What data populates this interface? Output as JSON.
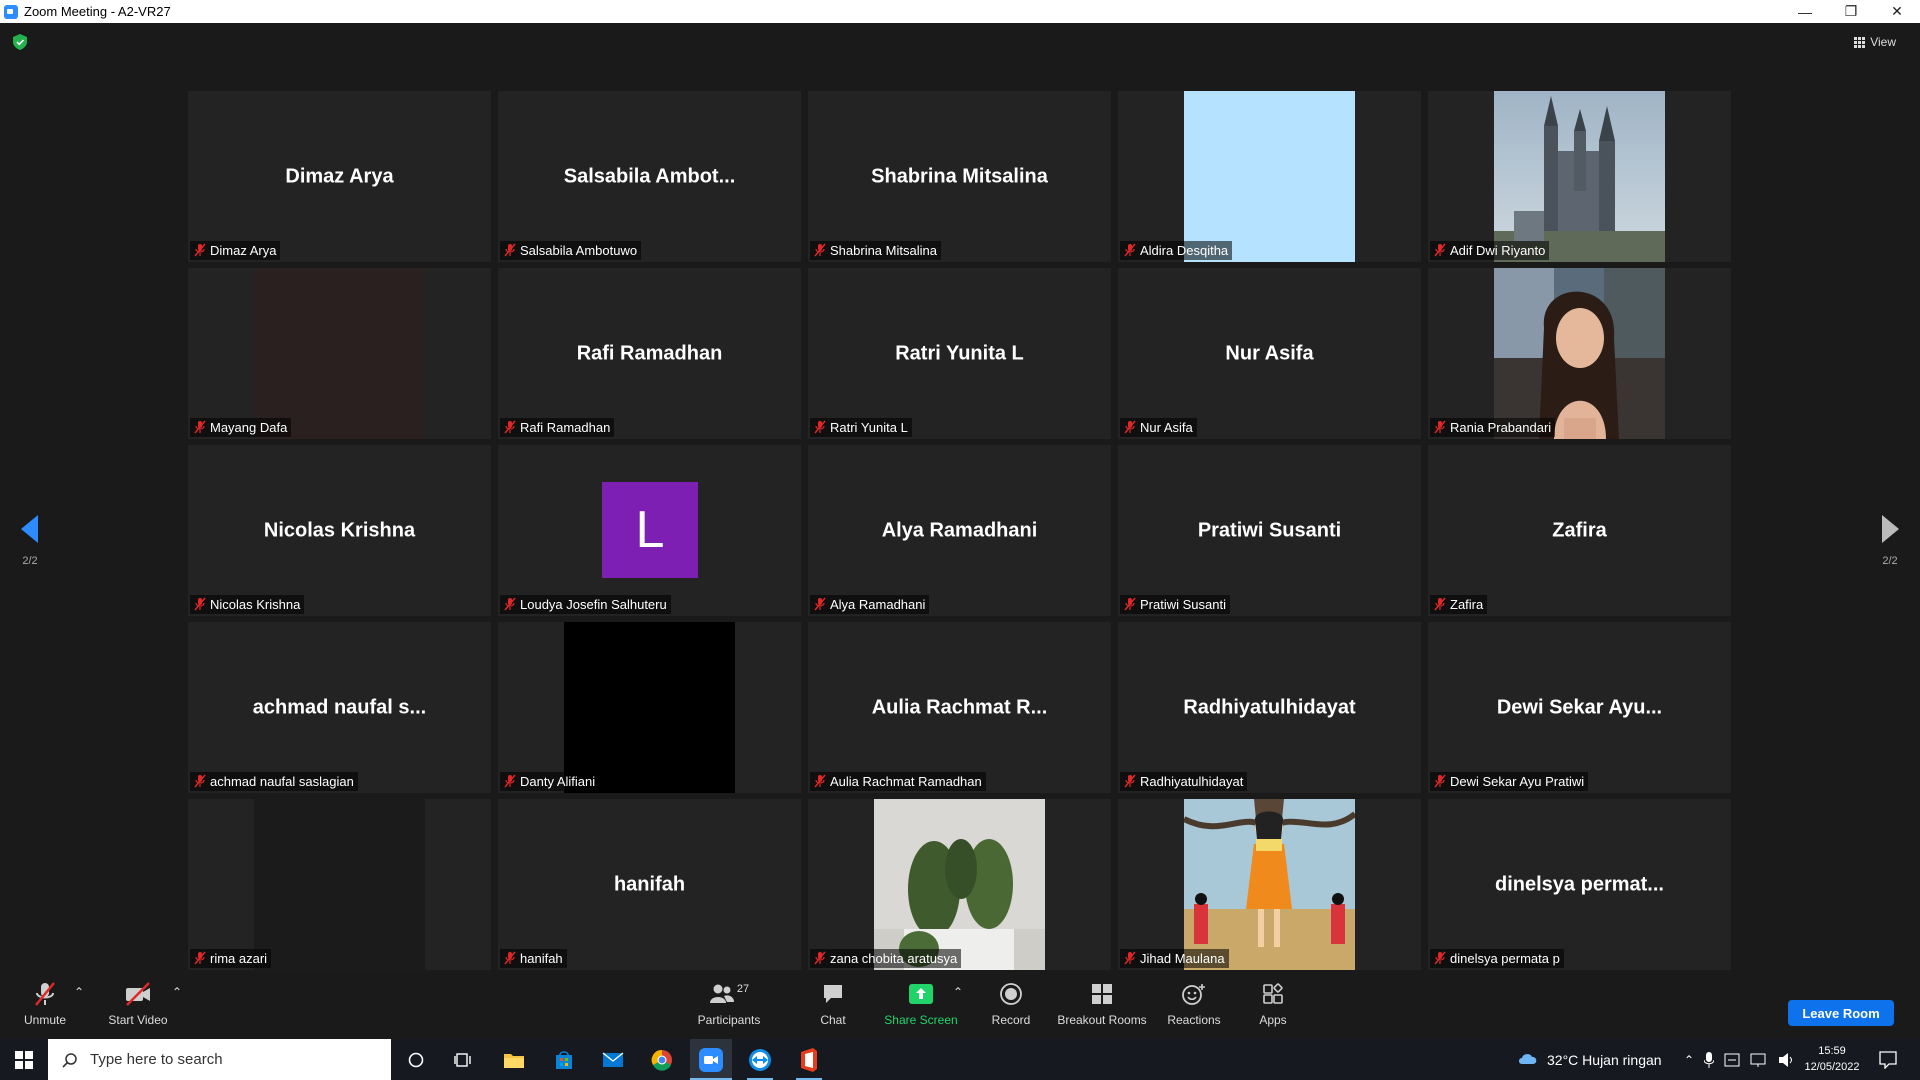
{
  "window": {
    "title": "Zoom Meeting - A2-VR27"
  },
  "view_label": "View",
  "pagination": {
    "left": "2/2",
    "right": "2/2"
  },
  "tiles": [
    {
      "display": "Dimaz Arya",
      "name": "Dimaz Arya",
      "kind": "text"
    },
    {
      "display": "Salsabila  Ambot...",
      "name": "Salsabila Ambotuwo",
      "kind": "text"
    },
    {
      "display": "Shabrina Mitsalina",
      "name": "Shabrina Mitsalina",
      "kind": "text"
    },
    {
      "display": "",
      "name": "Aldira Desqitha",
      "kind": "lightblue"
    },
    {
      "display": "",
      "name": "Adif Dwi Riyanto",
      "kind": "castle"
    },
    {
      "display": "",
      "name": "Mayang Dafa",
      "kind": "darkvideo"
    },
    {
      "display": "Rafi Ramadhan",
      "name": "Rafi Ramadhan",
      "kind": "text"
    },
    {
      "display": "Ratri Yunita L",
      "name": "Ratri Yunita L",
      "kind": "text"
    },
    {
      "display": "Nur Asifa",
      "name": "Nur Asifa",
      "kind": "text"
    },
    {
      "display": "",
      "name": "Rania Prabandari",
      "kind": "portrait"
    },
    {
      "display": "Nicolas Krishna",
      "name": "Nicolas Krishna",
      "kind": "text"
    },
    {
      "display": "L",
      "name": "Loudya Josefin Salhuteru",
      "kind": "avatar"
    },
    {
      "display": "Alya Ramadhani",
      "name": "Alya Ramadhani",
      "kind": "text"
    },
    {
      "display": "Pratiwi Susanti",
      "name": "Pratiwi Susanti",
      "kind": "text"
    },
    {
      "display": "Zafira",
      "name": "Zafira",
      "kind": "text"
    },
    {
      "display": "achmad naufal s...",
      "name": "achmad naufal saslagian",
      "kind": "text"
    },
    {
      "display": "",
      "name": "Danty Alifiani",
      "kind": "black"
    },
    {
      "display": "Aulia Rachmat R...",
      "name": "Aulia Rachmat Ramadhan",
      "kind": "text"
    },
    {
      "display": "Radhiyatulhidayat",
      "name": "Radhiyatulhidayat",
      "kind": "text"
    },
    {
      "display": "Dewi Sekar Ayu...",
      "name": "Dewi Sekar Ayu Pratiwi",
      "kind": "text"
    },
    {
      "display": "",
      "name": "rima azari",
      "kind": "darkvideo2"
    },
    {
      "display": "hanifah",
      "name": "hanifah",
      "kind": "text"
    },
    {
      "display": "",
      "name": "zana chobita aratusya",
      "kind": "cactus"
    },
    {
      "display": "",
      "name": "Jihad Maulana",
      "kind": "doll"
    },
    {
      "display": "dinelsya  permat...",
      "name": "dinelsya permata p",
      "kind": "text"
    }
  ],
  "toolbar": {
    "unmute": "Unmute",
    "start_video": "Start Video",
    "participants": "Participants",
    "participants_count": "27",
    "chat": "Chat",
    "share_screen": "Share Screen",
    "record": "Record",
    "breakout_rooms": "Breakout Rooms",
    "reactions": "Reactions",
    "apps": "Apps",
    "leave": "Leave Room"
  },
  "taskbar": {
    "search_placeholder": "Type here to search",
    "weather": "32°C  Hujan ringan",
    "time": "15:59",
    "date": "12/05/2022"
  },
  "colors": {
    "accent": "#0e72ed",
    "share_green": "#21d46a",
    "mute_red": "#e02828",
    "avatar_purple": "#7c1fb2"
  }
}
